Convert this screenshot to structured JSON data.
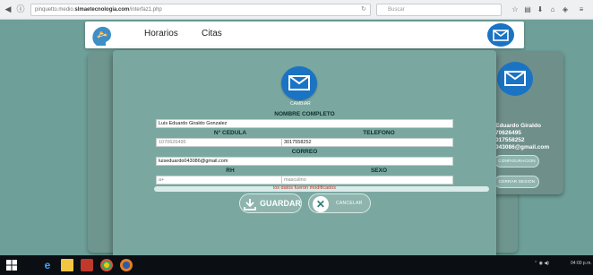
{
  "browser": {
    "url_prefix": "pinquetto.medio.",
    "url_host": "slmaetecnologia.com",
    "url_path": "/interfaz1.php",
    "search_placeholder": "Buscar"
  },
  "header": {
    "nav": [
      "Horarios",
      "Citas"
    ]
  },
  "side_panel": {
    "name": "Eduardo Giraldo",
    "cedula": "70626495",
    "telefono": "017558252",
    "email": "043086@gmail.com",
    "config_button": "CONFIGURACION",
    "logout_button": "CERRAR SESION"
  },
  "modal": {
    "change_label": "CAMBIAR",
    "full_name_label": "NOMBRE COMPLETO",
    "full_name_value": "Luis Eduardo Giraldo Gonzalez",
    "cedula_label": "N° CEDULA",
    "cedula_value": "1070626495",
    "phone_label": "TELEFONO",
    "phone_value": "3017558252",
    "email_label": "CORREO",
    "email_value": "luiseduardo043086@gmail.com",
    "rh_label": "RH",
    "rh_value": "a+",
    "sex_label": "SEXO",
    "sex_value": "masculino",
    "status_message": "los datos fueron modificados",
    "save_button": "GUARDAR",
    "cancel_button": "CANCELAR"
  },
  "taskbar": {
    "clock": "04:00 p.m."
  },
  "colors": {
    "page_bg": "#6e9f98",
    "modal_bg": "#7aa8a1",
    "mail_icon_bg": "#1b73c3",
    "status_text": "#c0392b"
  }
}
